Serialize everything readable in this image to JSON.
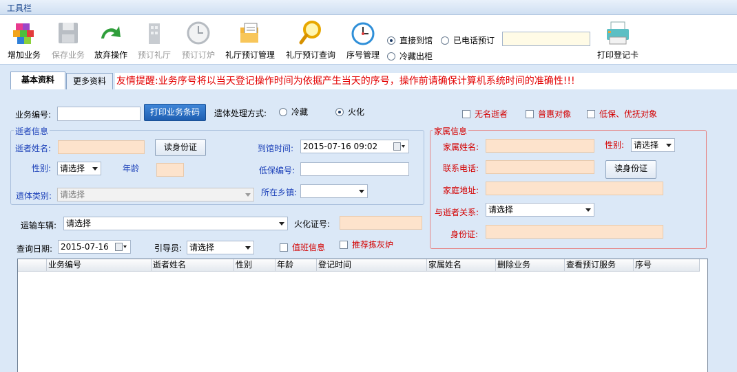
{
  "toolbar_title": "工具栏",
  "toolbar": {
    "add": "增加业务",
    "save": "保存业务",
    "abandon": "放弃操作",
    "book_hall": "预订礼厅",
    "book_furnace": "预订订炉",
    "hall_booking_mgmt": "礼厅预订管理",
    "hall_booking_query": "礼厅预订查询",
    "seq_mgmt": "序号管理",
    "print_card": "打印登记卡"
  },
  "arrival": {
    "direct": "直接到馆",
    "phone": "已电话预订",
    "cold_out": "冷藏出柜",
    "selected": "直接到馆"
  },
  "tabs": {
    "basic": "基本资料",
    "more": "更多资料"
  },
  "notice": "友情提醒:业务序号将以当天登记操作时间为依据产生当天的序号，操作前请确保计算机系统时间的准确性!!!",
  "form": {
    "biz_no_label": "业务编号:",
    "biz_no_value": "",
    "print_barcode": "打印业务条码",
    "handling_label": "遗体处理方式:",
    "handling_cold": "冷藏",
    "handling_cremation": "火化",
    "handling_selected": "火化",
    "anon": "无名逝者",
    "preferential": "普惠对像",
    "low_income": "低保、优抚对象"
  },
  "deceased": {
    "title": "逝者信息",
    "name_label": "逝者姓名:",
    "read_id": "读身份证",
    "arrival_time_label": "到馆时间:",
    "arrival_time_value": "2015-07-16 09:02",
    "gender_label": "性别:",
    "gender_value": "请选择",
    "age_label": "年龄",
    "low_income_no_label": "低保编号:",
    "type_label": "遗体类别:",
    "type_value": "请选择",
    "town_label": "所在乡镇:"
  },
  "family": {
    "title": "家属信息",
    "name_label": "家属姓名:",
    "gender_label": "性别:",
    "gender_value": "请选择",
    "phone_label": "联系电话:",
    "read_id": "读身份证",
    "address_label": "家庭地址:",
    "relation_label": "与逝者关系:",
    "relation_value": "请选择",
    "id_label": "身份证:"
  },
  "transport": {
    "vehicle_label": "运输车辆:",
    "vehicle_value": "请选择",
    "cremation_no_label": "火化证号:",
    "query_date_label": "查询日期:",
    "query_date_value": "2015-07-16",
    "guide_label": "引导员:",
    "guide_value": "请选择",
    "duty_info": "值班信息",
    "recommend": "推荐拣灰炉"
  },
  "grid": {
    "columns": [
      "业务编号",
      "逝者姓名",
      "性别",
      "年龄",
      "登记时间",
      "家属姓名",
      "删除业务",
      "查看预订服务",
      "序号"
    ],
    "rows": []
  }
}
